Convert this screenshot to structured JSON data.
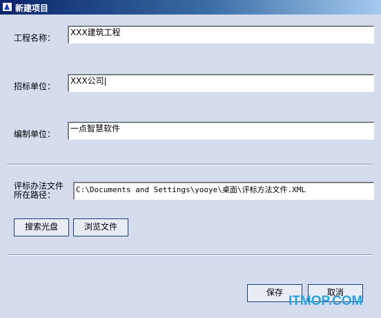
{
  "window": {
    "title": "新建项目"
  },
  "form": {
    "project_name": {
      "label": "工程名称：",
      "value": "XXX建筑工程"
    },
    "tendering_unit": {
      "label": "招标单位：",
      "value": "XXX公司"
    },
    "compiling_unit": {
      "label": "编制单位：",
      "value": "一点智慧软件"
    },
    "eval_path": {
      "label_line1": "评标办法文件",
      "label_line2": "所在路径：",
      "value": "C:\\Documents and Settings\\yooye\\桌面\\评标方法文件.XML"
    }
  },
  "buttons": {
    "search_disc": "搜索光盘",
    "browse_file": "浏览文件",
    "save": "保存",
    "cancel": "取消"
  },
  "watermark": "ITMOP.COM"
}
